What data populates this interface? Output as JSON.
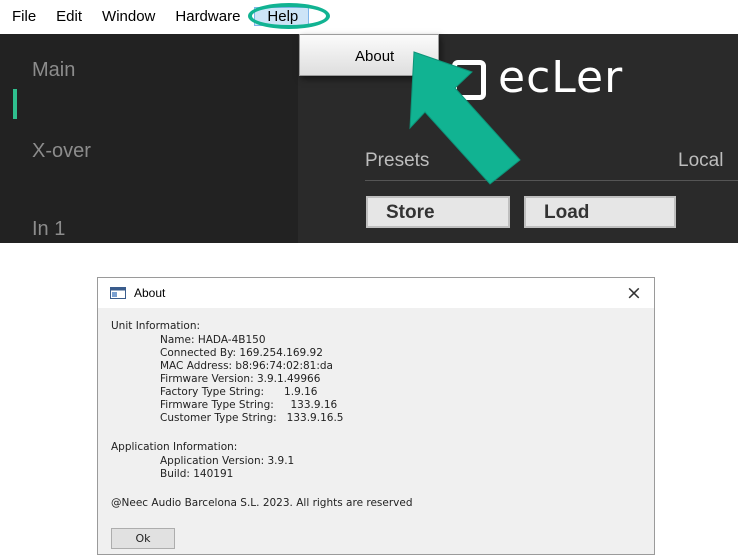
{
  "menubar": {
    "items": [
      "File",
      "Edit",
      "Window",
      "Hardware"
    ],
    "help": "Help"
  },
  "help_menu": {
    "about": "About"
  },
  "sidebar": {
    "items": [
      "Main",
      "X-over",
      "In 1"
    ]
  },
  "brand": {
    "logo_text": "ecLer"
  },
  "presets": {
    "label": "Presets",
    "local_label": "Local",
    "store": "Store",
    "load": "Load"
  },
  "about_dialog": {
    "title": "About",
    "close": "×",
    "unit_header": "Unit Information:",
    "name": "Name: HADA-4B150",
    "connected_by": "Connected By: 169.254.169.92",
    "mac": "MAC Address: b8:96:74:02:81:da",
    "firmware_version": "Firmware Version: 3.9.1.49966",
    "factory_type": "Factory Type String:      1.9.16",
    "firmware_type": "Firmware Type String:     133.9.16",
    "customer_type": "Customer Type String:   133.9.16.5",
    "app_header": "Application Information:",
    "app_version": "Application Version: 3.9.1",
    "build": "Build: 140191",
    "copyright": "@Neec Audio Barcelona S.L. 2023. All rights are reserved",
    "ok": "Ok"
  },
  "colors": {
    "highlight_accent": "#11b392",
    "sidebar_active": "#2fbf8e"
  }
}
